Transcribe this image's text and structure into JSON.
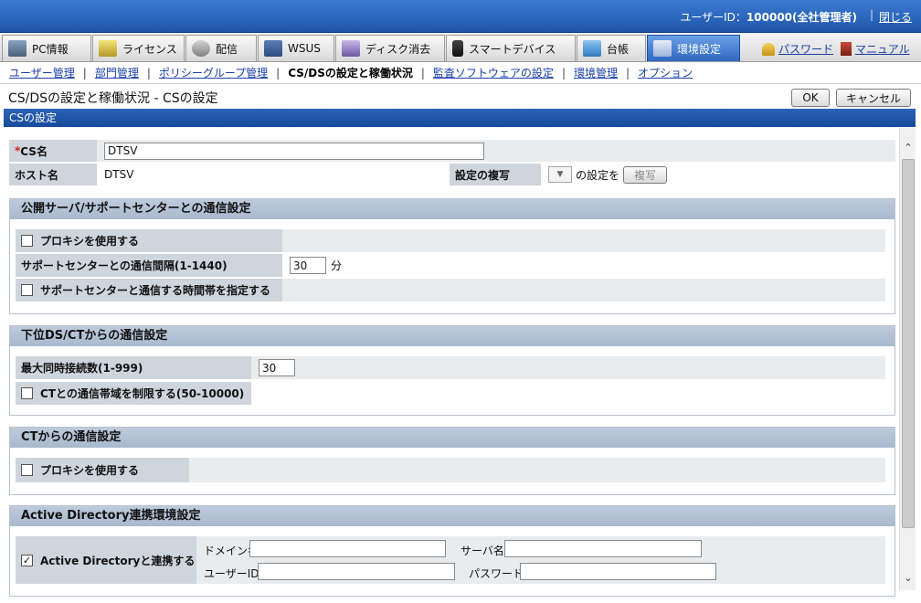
{
  "header": {
    "user_label": "ユーザーID：",
    "user_value": "100000(全社管理者)",
    "separator": "|",
    "logout": "閉じる"
  },
  "tabs": [
    {
      "label": "PC情報",
      "icon": "pc-icon"
    },
    {
      "label": "ライセンス",
      "icon": "license-icon"
    },
    {
      "label": "配信",
      "icon": "distribution-icon"
    },
    {
      "label": "WSUS",
      "icon": "wsus-icon"
    },
    {
      "label": "ディスク消去",
      "icon": "disk-erase-icon"
    },
    {
      "label": "スマートデバイス",
      "icon": "smart-device-icon"
    },
    {
      "label": "台帳",
      "icon": "ledger-icon"
    },
    {
      "label": "環境設定",
      "icon": "tools-icon",
      "active": true
    }
  ],
  "tab_links": {
    "password": "パスワード",
    "manual": "マニュアル"
  },
  "subnav": {
    "items": [
      "ユーザー管理",
      "部門管理",
      "ポリシーグループ管理",
      "CS/DSの設定と稼働状況",
      "監査ソフトウェアの設定",
      "環境管理",
      "オプション"
    ],
    "current_index": 3,
    "separator": "|"
  },
  "page": {
    "title": "CS/DSの設定と稼働状況 - CSの設定",
    "ok_label": "OK",
    "cancel_label": "キャンセル",
    "section_title": "CSの設定"
  },
  "cs": {
    "required_mark": "*",
    "name_label": "CS名",
    "name_value": "DTSV",
    "host_label": "ホスト名",
    "host_value": "DTSV",
    "copy_label": "設定の複写",
    "copy_suffix": "の設定を",
    "copy_button": "複写"
  },
  "public_server": {
    "title": "公開サーバ/サポートセンターとの通信設定",
    "proxy_label": "プロキシを使用する",
    "proxy_checked": false,
    "interval_label": "サポートセンターとの通信間隔(1-1440)",
    "interval_value": "30",
    "interval_unit": "分",
    "timeslot_label": "サポートセンターと通信する時間帯を指定する",
    "timeslot_checked": false
  },
  "lower_ds": {
    "title": "下位DS/CTからの通信設定",
    "max_conn_label": "最大同時接続数(1-999)",
    "max_conn_value": "30",
    "bandwidth_label": "CTとの通信帯域を制限する(50-10000)",
    "bandwidth_checked": false
  },
  "ct": {
    "title": "CTからの通信設定",
    "proxy_label": "プロキシを使用する",
    "proxy_checked": false
  },
  "ad": {
    "title": "Active Directory連携環境設定",
    "link_label": "Active Directoryと連携する",
    "link_checked": true,
    "check_mark": "✓",
    "domain_label": "ドメイン名",
    "domain_value": "",
    "server_label": "サーバ名",
    "server_value": "",
    "user_label": "ユーザーID",
    "user_value": "",
    "password_label": "パスワード",
    "password_value": ""
  },
  "scroll": {
    "up": "⌃",
    "down": "⌄"
  }
}
